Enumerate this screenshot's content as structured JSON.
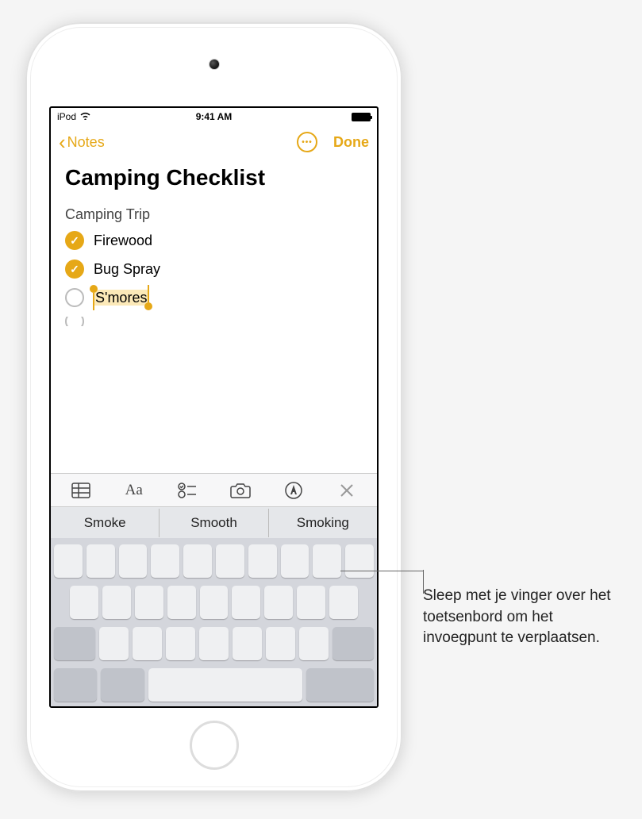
{
  "status_bar": {
    "device": "iPod",
    "time": "9:41 AM"
  },
  "nav": {
    "back_label": "Notes",
    "done_label": "Done"
  },
  "note": {
    "title": "Camping Checklist",
    "section": "Camping Trip",
    "items": [
      {
        "label": "Firewood",
        "checked": true
      },
      {
        "label": "Bug Spray",
        "checked": true
      },
      {
        "label": "S'mores",
        "checked": false,
        "selected": true
      }
    ]
  },
  "suggestions": [
    "Smoke",
    "Smooth",
    "Smoking"
  ],
  "callout": "Sleep met je vinger over het toetsenbord om het invoegpunt te verplaatsen."
}
